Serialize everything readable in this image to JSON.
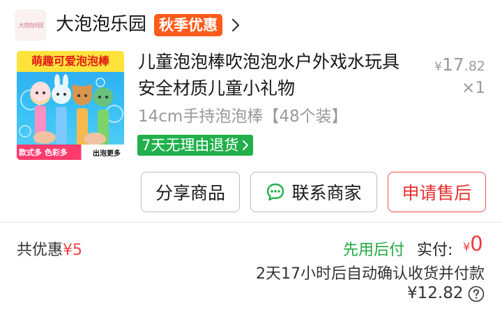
{
  "shop": {
    "logo_text": "大泡泡乐园",
    "name": "大泡泡乐园",
    "promo_badge": "秋季优惠"
  },
  "product": {
    "image": {
      "banner_text": "萌趣可爱泡泡棒",
      "footer_left": "款式多 色彩多",
      "footer_right": "出泡更多"
    },
    "title": "儿童泡泡棒吹泡泡水户外戏水玩具安全材质儿童小礼物",
    "price": {
      "currency": "¥",
      "integer": "17",
      "decimal": ".82"
    },
    "quantity": "×1",
    "spec": "14cm手持泡泡棒【48个装】",
    "return_tag": "7天无理由退货"
  },
  "actions": {
    "share_label": "分享商品",
    "contact_label": "联系商家",
    "aftersale_label": "申请售后"
  },
  "summary": {
    "discount_label": "共优惠",
    "discount_value": "¥5",
    "pay_later": "先用后付",
    "paid_label": "实付:",
    "paid_currency": "¥",
    "paid_value": "0",
    "auto_confirm": "2天17小时后自动确认收货并付款",
    "total": "¥12.82"
  },
  "colors": {
    "promo": "#ff5b1b",
    "green": "#21b04b",
    "red": "#f04141"
  }
}
